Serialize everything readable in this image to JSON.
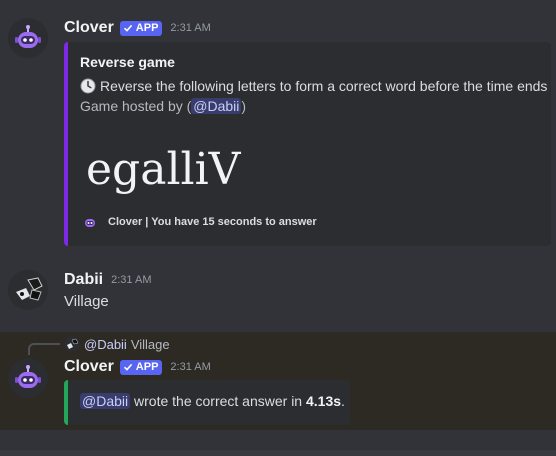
{
  "colors": {
    "background": "#313338",
    "embed_accent_purple": "#7d2ae8",
    "embed_accent_green": "#23a55a",
    "app_badge": "#5865f2",
    "highlight_band": "#2d2a24"
  },
  "message1": {
    "username": "Clover",
    "badge": "APP",
    "timestamp": "2:31 AM",
    "avatar_icon": "robot-icon",
    "embed": {
      "title": "Reverse game",
      "clock_icon": "clock-icon",
      "description": "Reverse the following letters to form a correct word before the time ends",
      "host_prefix": "Game hosted by (",
      "host_mention": "@Dabii",
      "host_suffix": ")",
      "scrambled_word": "egalliV",
      "footer_text": "Clover | You have 15 seconds to answer"
    }
  },
  "message2": {
    "username": "Dabii",
    "timestamp": "2:31 AM",
    "text": "Village",
    "avatar_icon": "user-avatar-icon"
  },
  "message3": {
    "reply_mention": "@Dabii",
    "reply_text": "Village",
    "username": "Clover",
    "badge": "APP",
    "timestamp": "2:31 AM",
    "embed": {
      "mention": "@Dabii",
      "text": "wrote the correct answer in",
      "time": "4.13s",
      "period": "."
    }
  }
}
